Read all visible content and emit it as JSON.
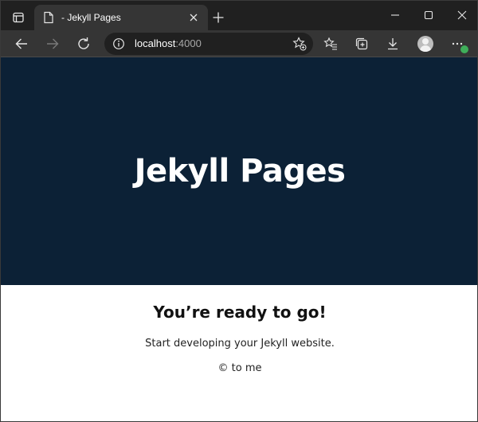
{
  "browser": {
    "tab": {
      "title": "- Jekyll Pages"
    },
    "address": {
      "host": "localhost",
      "port": ":4000"
    },
    "colors": {
      "tabstrip": "#202020",
      "toolbar": "#353535",
      "omnibox": "#202020",
      "badge": "#3fae5a"
    }
  },
  "page": {
    "hero_title": "Jekyll Pages",
    "heading": "You’re ready to go!",
    "lead": "Start developing your Jekyll website.",
    "footer": "© to me",
    "colors": {
      "hero_bg": "#0c2136",
      "hero_text": "#ffffff"
    }
  },
  "icons": {
    "tab_actions": "tab-actions-icon",
    "favicon": "page-icon",
    "tab_close": "close-icon",
    "new_tab": "plus-icon",
    "minimize": "minimize-icon",
    "maximize": "maximize-icon",
    "close_window": "close-icon",
    "back": "back-arrow-icon",
    "forward": "forward-arrow-icon",
    "refresh": "refresh-icon",
    "site_info": "info-icon",
    "add_favorite": "star-plus-icon",
    "favorites": "favorites-icon",
    "collections": "collections-icon",
    "downloads": "download-icon",
    "profile": "avatar-icon",
    "more": "more-icon"
  }
}
